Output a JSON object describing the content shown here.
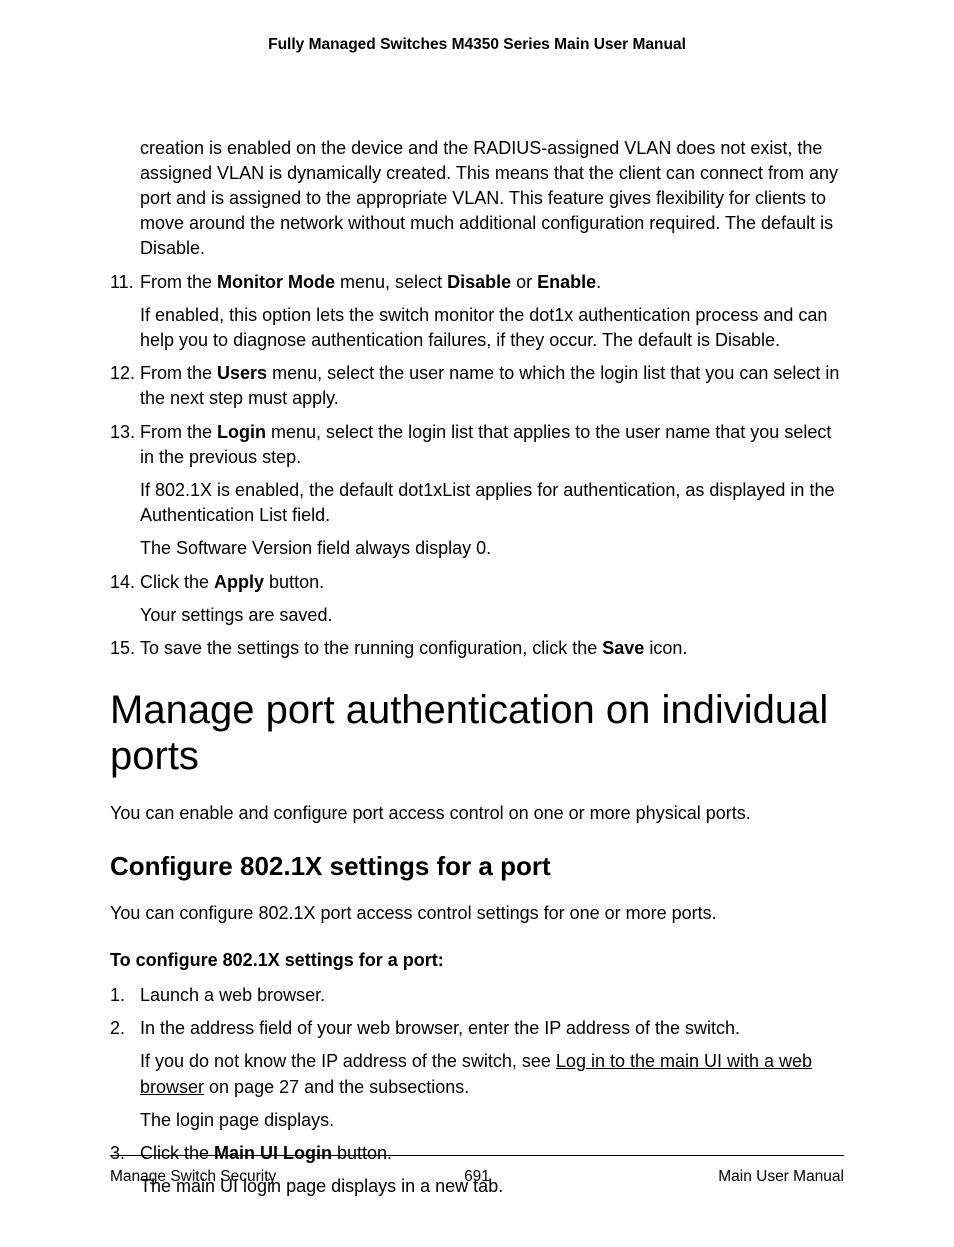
{
  "header": {
    "title": "Fully Managed Switches M4350 Series Main User Manual"
  },
  "continued_para": "creation is enabled on the device and the RADIUS-assigned VLAN does not exist, the assigned VLAN is dynamically created. This means that the client can connect from any port and is assigned to the appropriate VLAN. This feature gives flexibility for clients to move around the network without much additional configuration required. The default is Disable.",
  "steps": {
    "s11": {
      "num": "11.",
      "prefix": "From the ",
      "bold1": "Monitor Mode",
      "mid1": " menu, select ",
      "bold2": "Disable",
      "mid2": " or ",
      "bold3": "Enable",
      "suffix": ".",
      "sub": "If enabled, this option lets the switch monitor the dot1x authentication process and can help you to diagnose authentication failures, if they occur. The default is Disable."
    },
    "s12": {
      "num": "12.",
      "prefix": "From the ",
      "bold1": "Users",
      "suffix": " menu, select the user name to which the login list that you can select in the next step must apply."
    },
    "s13": {
      "num": "13.",
      "prefix": "From the ",
      "bold1": "Login",
      "suffix": " menu, select the login list that applies to the user name that you select in the previous step.",
      "sub1": "If 802.1X is enabled, the default dot1xList applies for authentication, as displayed in the Authentication List field.",
      "sub2": "The Software Version field always display 0."
    },
    "s14": {
      "num": "14.",
      "prefix": "Click the ",
      "bold1": "Apply",
      "suffix": " button.",
      "sub": "Your settings are saved."
    },
    "s15": {
      "num": "15.",
      "prefix": "To save the settings to the running configuration, click the ",
      "bold1": "Save",
      "suffix": " icon."
    }
  },
  "section": {
    "title": "Manage port authentication on individual ports",
    "intro": "You can enable and configure port access control on one or more physical ports."
  },
  "subsection": {
    "title": "Configure 802.1X settings for a port",
    "intro": "You can configure 802.1X port access control settings for one or more ports.",
    "procedure_title": "To configure 802.1X settings for a port:"
  },
  "proc": {
    "p1": {
      "num": "1.",
      "text": "Launch a web browser."
    },
    "p2": {
      "num": "2.",
      "text": "In the address field of your web browser, enter the IP address of the switch.",
      "sub_prefix": "If you do not know the IP address of the switch, see ",
      "sub_link": "Log in to the main UI with a web browser",
      "sub_suffix": " on page 27 and the subsections.",
      "sub2": "The login page displays."
    },
    "p3": {
      "num": "3.",
      "prefix": "Click the ",
      "bold1": "Main UI Login",
      "suffix": " button.",
      "sub": "The main UI login page displays in a new tab."
    }
  },
  "footer": {
    "left": "Manage Switch Security",
    "center": "691",
    "right": "Main User Manual"
  }
}
